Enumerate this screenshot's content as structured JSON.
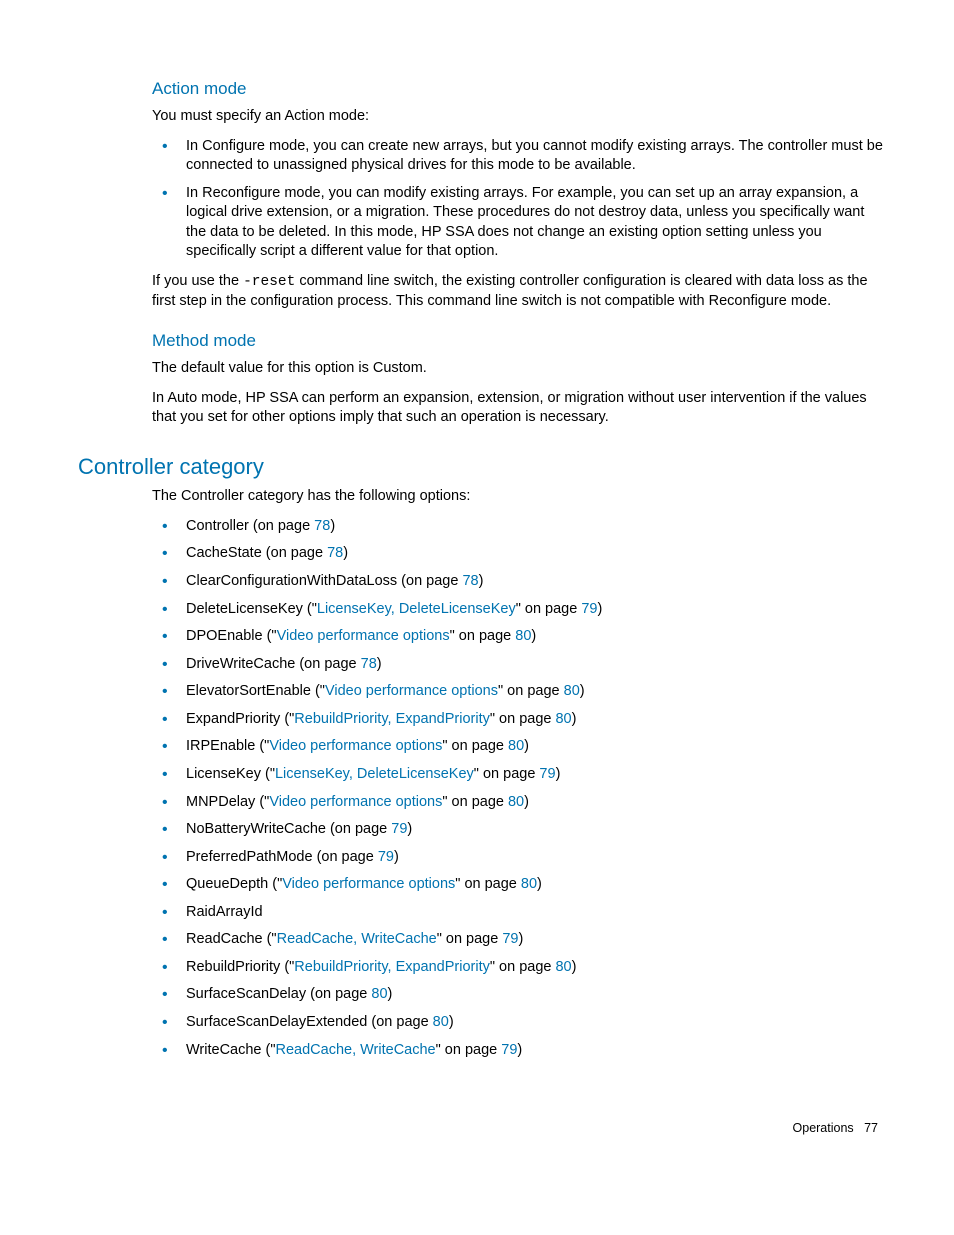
{
  "s1": {
    "heading": "Action mode",
    "p1": "You must specify an Action mode:",
    "b1": "In Configure mode, you can create new arrays, but you cannot modify existing arrays. The controller must be connected to unassigned physical drives for this mode to be available.",
    "b2": "In Reconfigure mode, you can modify existing arrays. For example, you can set up an array expansion, a logical drive extension, or a migration. These procedures do not destroy data, unless you specifically want the data to be deleted. In this mode, HP SSA does not change an existing option setting unless you specifically script a different value for that option.",
    "p2a": "If you use the ",
    "p2code": "-reset",
    "p2b": " command line switch, the existing controller configuration is cleared with data loss as the first step in the configuration process. This command line switch is not compatible with Reconfigure mode."
  },
  "s2": {
    "heading": "Method mode",
    "p1": "The default value for this option is Custom.",
    "p2": "In Auto mode, HP SSA can perform an expansion, extension, or migration without user intervention if the values that you set for other options imply that such an operation is necessary."
  },
  "s3": {
    "heading": "Controller category",
    "intro": "The Controller category has the following options:",
    "items": [
      {
        "pre": "Controller (on page ",
        "link": "78",
        "post": ")"
      },
      {
        "pre": "CacheState (on page ",
        "link": "78",
        "post": ")"
      },
      {
        "pre": "ClearConfigurationWithDataLoss (on page ",
        "link": "78",
        "post": ")"
      },
      {
        "pre": "DeleteLicenseKey (\"",
        "link": "LicenseKey, DeleteLicenseKey",
        "mid": "\" on page ",
        "link2": "79",
        "post": ")"
      },
      {
        "pre": "DPOEnable (\"",
        "link": "Video performance options",
        "mid": "\" on page ",
        "link2": "80",
        "post": ")"
      },
      {
        "pre": "DriveWriteCache (on page ",
        "link": "78",
        "post": ")"
      },
      {
        "pre": "ElevatorSortEnable (\"",
        "link": "Video performance options",
        "mid": "\" on page ",
        "link2": "80",
        "post": ")"
      },
      {
        "pre": "ExpandPriority (\"",
        "link": "RebuildPriority, ExpandPriority",
        "mid": "\" on page ",
        "link2": "80",
        "post": ")"
      },
      {
        "pre": "IRPEnable (\"",
        "link": "Video performance options",
        "mid": "\" on page ",
        "link2": "80",
        "post": ")"
      },
      {
        "pre": "LicenseKey (\"",
        "link": "LicenseKey, DeleteLicenseKey",
        "mid": "\" on page ",
        "link2": "79",
        "post": ")"
      },
      {
        "pre": "MNPDelay (\"",
        "link": "Video performance options",
        "mid": "\" on page ",
        "link2": "80",
        "post": ")"
      },
      {
        "pre": "NoBatteryWriteCache (on page ",
        "link": "79",
        "post": ")"
      },
      {
        "pre": "PreferredPathMode (on page ",
        "link": "79",
        "post": ")"
      },
      {
        "pre": "QueueDepth (\"",
        "link": "Video performance options",
        "mid": "\" on page ",
        "link2": "80",
        "post": ")"
      },
      {
        "pre": "RaidArrayId"
      },
      {
        "pre": "ReadCache (\"",
        "link": "ReadCache, WriteCache",
        "mid": "\" on page ",
        "link2": "79",
        "post": ")"
      },
      {
        "pre": "RebuildPriority (\"",
        "link": "RebuildPriority, ExpandPriority",
        "mid": "\" on page ",
        "link2": "80",
        "post": ")"
      },
      {
        "pre": "SurfaceScanDelay (on page ",
        "link": "80",
        "post": ")"
      },
      {
        "pre": "SurfaceScanDelayExtended (on page ",
        "link": "80",
        "post": ")"
      },
      {
        "pre": "WriteCache (\"",
        "link": "ReadCache, WriteCache",
        "mid": "\" on page ",
        "link2": "79",
        "post": ")"
      }
    ]
  },
  "footer": {
    "section": "Operations",
    "page": "77"
  }
}
